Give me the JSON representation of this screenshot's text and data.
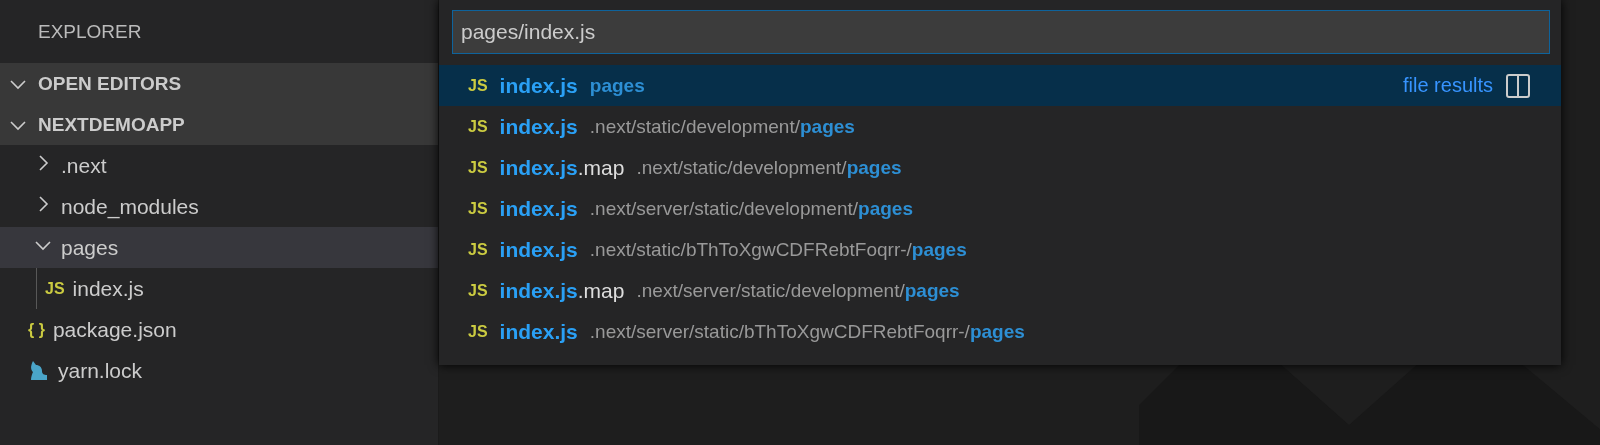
{
  "sidebar": {
    "title": "EXPLORER",
    "sections": [
      {
        "label": "OPEN EDITORS",
        "expanded": true
      },
      {
        "label": "NEXTDEMOAPP",
        "expanded": true
      }
    ],
    "tree": [
      {
        "kind": "folder",
        "label": ".next",
        "expanded": false,
        "selected": false
      },
      {
        "kind": "folder",
        "label": "node_modules",
        "expanded": false,
        "selected": false
      },
      {
        "kind": "folder",
        "label": "pages",
        "expanded": true,
        "selected": true,
        "children": [
          {
            "kind": "js",
            "icon": "JS",
            "label": "index.js",
            "selected": false
          }
        ]
      },
      {
        "kind": "json",
        "icon": "{ }",
        "label": "package.json",
        "selected": false
      },
      {
        "kind": "yarn",
        "label": "yarn.lock",
        "selected": false
      }
    ]
  },
  "quick_open": {
    "value": "pages/index.js",
    "results": [
      {
        "icon": "JS",
        "name_match": "index.js",
        "path_match": "pages",
        "selected": true,
        "tag": "file results"
      },
      {
        "icon": "JS",
        "name_match": "index.js",
        "path": ".next/static/development/",
        "path_match": "pages",
        "selected": false
      },
      {
        "icon": "JS",
        "name_match": "index.js",
        "name_rest": ".map",
        "path": ".next/static/development/",
        "path_match": "pages",
        "selected": false
      },
      {
        "icon": "JS",
        "name_match": "index.js",
        "path": ".next/server/static/development/",
        "path_match": "pages",
        "selected": false
      },
      {
        "icon": "JS",
        "name_match": "index.js",
        "path": ".next/static/bThToXgwCDFRebtFoqrr-/",
        "path_match": "pages",
        "selected": false
      },
      {
        "icon": "JS",
        "name_match": "index.js",
        "name_rest": ".map",
        "path": ".next/server/static/development/",
        "path_match": "pages",
        "selected": false
      },
      {
        "icon": "JS",
        "name_match": "index.js",
        "path": ".next/server/static/bThToXgwCDFRebtFoqrr-/",
        "path_match": "pages",
        "selected": false
      }
    ]
  }
}
